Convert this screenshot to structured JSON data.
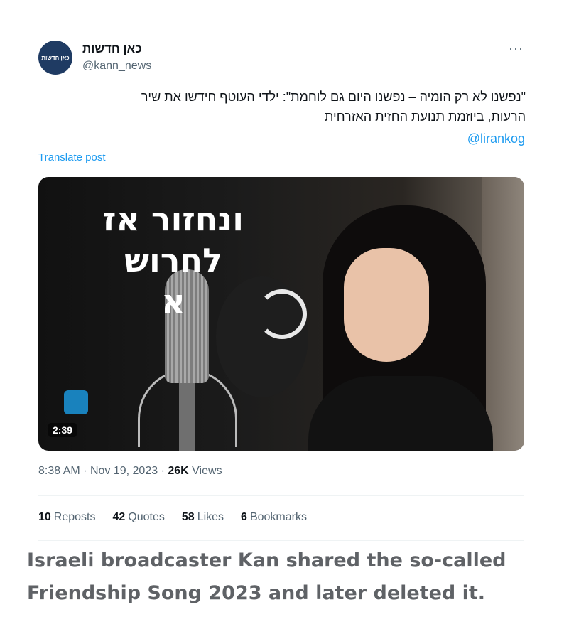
{
  "post": {
    "avatar_text": "כאן חדשות",
    "display_name": "כאן חדשות",
    "handle": "@kann_news",
    "more_icon": "···",
    "text_line1": "\"נפשנו לא רק הומיה – נפשנו היום גם לוחמת\": ילדי העוטף חידשו את שיר",
    "text_line2": "הרעות, ביוזמת תנועת החזית האזרחית",
    "mention": "@lirankog",
    "translate": "Translate post",
    "media": {
      "overlay_line1": "ונחזור אז",
      "overlay_line2": "לחרוש",
      "overlay_line3": "א",
      "duration": "2:39"
    },
    "time": "8:38 AM",
    "date": "Nov 19, 2023",
    "views_count": "26K",
    "views_label": "Views",
    "stats": {
      "reposts_count": "10",
      "reposts_label": "Reposts",
      "quotes_count": "42",
      "quotes_label": "Quotes",
      "likes_count": "58",
      "likes_label": "Likes",
      "bookmarks_count": "6",
      "bookmarks_label": "Bookmarks"
    }
  },
  "caption": {
    "line1": "Israeli broadcaster Kan shared the so-called",
    "line2": "Friendship Song 2023 and later deleted it."
  },
  "colors": {
    "link": "#1d9bf0",
    "secondary": "#536471",
    "caption": "#5f6266"
  }
}
